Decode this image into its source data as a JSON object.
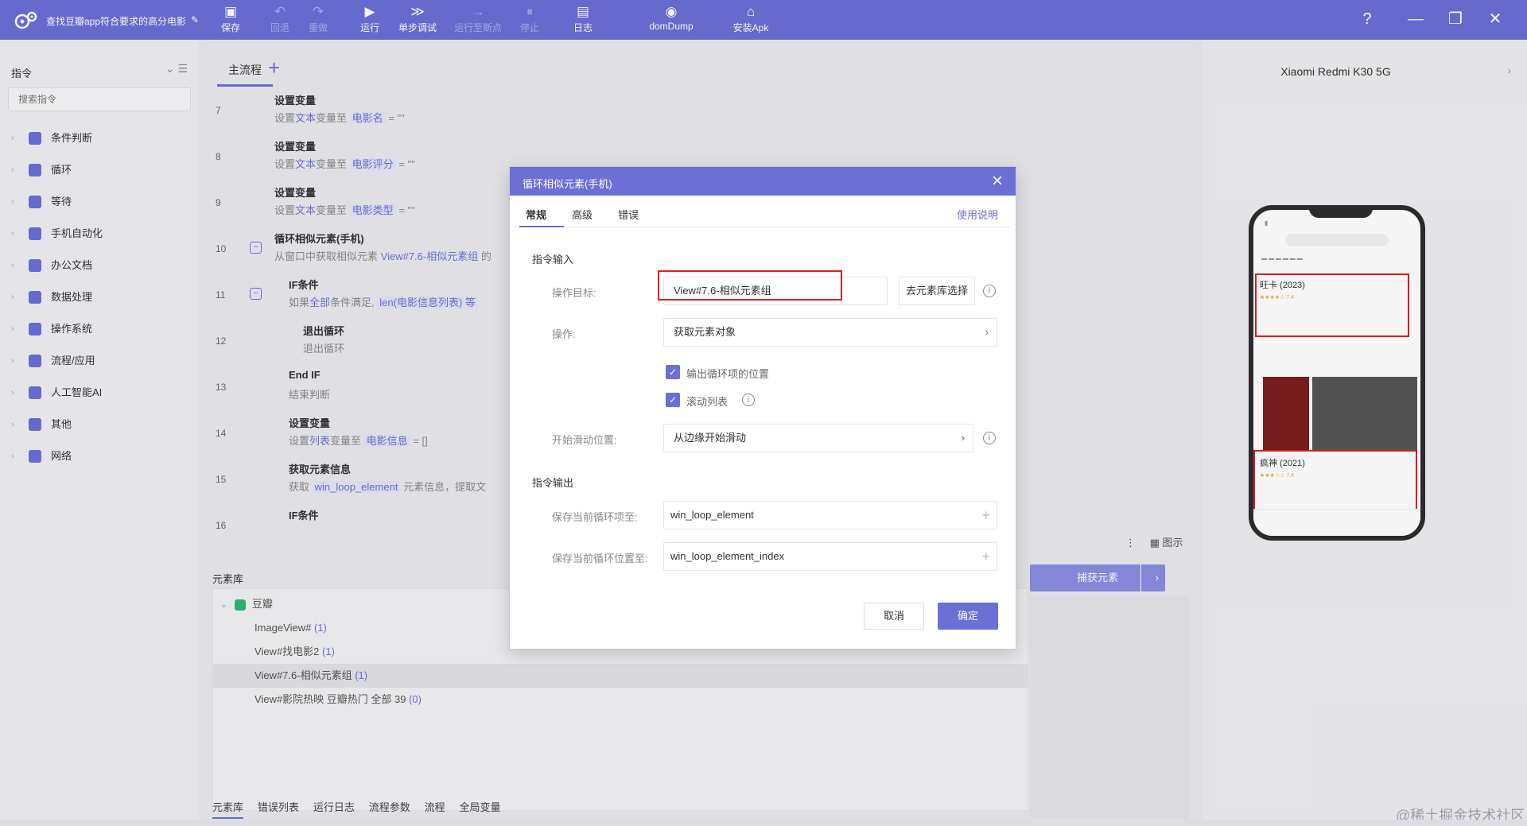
{
  "app": {
    "title": "查找豆瓣app符合要求的高分电影"
  },
  "toolbar": {
    "items": [
      {
        "label": "保存",
        "icon": "save-icon",
        "enabled": true
      },
      {
        "label": "回退",
        "icon": "undo-icon",
        "enabled": false
      },
      {
        "label": "重做",
        "icon": "redo-icon",
        "enabled": false
      },
      {
        "label": "运行",
        "icon": "play-icon",
        "enabled": true
      },
      {
        "label": "单步调试",
        "icon": "step-debug-icon",
        "enabled": true
      },
      {
        "label": "运行至断点",
        "icon": "run-to-breakpoint-icon",
        "enabled": false
      },
      {
        "label": "停止",
        "icon": "stop-icon",
        "enabled": false
      },
      {
        "label": "日志",
        "icon": "log-icon",
        "enabled": true
      },
      {
        "label": "domDump",
        "icon": "dom-dump-icon",
        "enabled": true
      },
      {
        "label": "安装Apk",
        "icon": "install-apk-icon",
        "enabled": true
      }
    ]
  },
  "left_panel": {
    "title": "指令",
    "search_placeholder": "搜索指令",
    "items": [
      {
        "label": "条件判断"
      },
      {
        "label": "循环"
      },
      {
        "label": "等待"
      },
      {
        "label": "手机自动化"
      },
      {
        "label": "办公文档"
      },
      {
        "label": "数据处理"
      },
      {
        "label": "操作系统"
      },
      {
        "label": "流程/应用"
      },
      {
        "label": "人工智能AI"
      },
      {
        "label": "其他"
      },
      {
        "label": "网络"
      }
    ]
  },
  "main": {
    "tab": "主流程",
    "steps": [
      {
        "num": "7",
        "title": "设置变量",
        "desc_prefix": "设置",
        "desc_type": "文本",
        "desc_mid": "变量至",
        "desc_var": "电影名",
        "desc_suffix": "= \"\""
      },
      {
        "num": "8",
        "title": "设置变量",
        "desc_prefix": "设置",
        "desc_type": "文本",
        "desc_mid": "变量至",
        "desc_var": "电影评分",
        "desc_suffix": "= \"\""
      },
      {
        "num": "9",
        "title": "设置变量",
        "desc_prefix": "设置",
        "desc_type": "文本",
        "desc_mid": "变量至",
        "desc_var": "电影类型",
        "desc_suffix": "= \"\""
      },
      {
        "num": "10",
        "title": "循环相似元素(手机)",
        "desc_prefix": "从窗口中获取相似元素",
        "desc_type": "View#7.6-相似元素组",
        "desc_mid": "的",
        "desc_var": "",
        "desc_suffix": ""
      },
      {
        "num": "11",
        "title": "IF条件",
        "desc_prefix": "如果",
        "desc_type": "全部",
        "desc_mid": "条件满足,",
        "desc_var": "len(电影信息列表) 等",
        "desc_suffix": ""
      },
      {
        "num": "12",
        "title": "退出循环",
        "desc_prefix": "退出循环",
        "desc_type": "",
        "desc_mid": "",
        "desc_var": "",
        "desc_suffix": ""
      },
      {
        "num": "13",
        "title": "End IF",
        "desc_prefix": "结束判断",
        "desc_type": "",
        "desc_mid": "",
        "desc_var": "",
        "desc_suffix": ""
      },
      {
        "num": "14",
        "title": "设置变量",
        "desc_prefix": "设置",
        "desc_type": "列表",
        "desc_mid": "变量至",
        "desc_var": "电影信息",
        "desc_suffix": "= []"
      },
      {
        "num": "15",
        "title": "获取元素信息",
        "desc_prefix": "获取",
        "desc_type": "",
        "desc_mid": "",
        "desc_var": "win_loop_element",
        "desc_suffix": "元素信息，提取文"
      },
      {
        "num": "16",
        "title": "IF条件",
        "desc_prefix": "",
        "desc_type": "",
        "desc_mid": "",
        "desc_var": "",
        "desc_suffix": ""
      }
    ]
  },
  "element_library": {
    "title": "元素库",
    "root": "豆瓣",
    "items": [
      {
        "name": "ImageView#",
        "count": "(1)",
        "selected": false
      },
      {
        "name": "View#找电影2",
        "count": "(1)",
        "selected": false
      },
      {
        "name": "View#7.6-相似元素组",
        "count": "(1)",
        "selected": true
      },
      {
        "name": "View#影院热映 豆瓣热门 全部 39",
        "count": "(0)",
        "selected": false
      }
    ],
    "show_image_label": "图示",
    "capture_button": "捕获元素",
    "bottom_tabs": [
      "元素库",
      "错误列表",
      "运行日志",
      "流程参数",
      "流程",
      "全局变量"
    ]
  },
  "device": {
    "name": "Xiaomi Redmi K30 5G",
    "cards": [
      {
        "title": "旺卡 (2023)",
        "rating": "★★★★☆ 7.4"
      },
      {
        "title": "疯神 (2021)",
        "rating": "★★★☆☆ 7.4"
      }
    ]
  },
  "dialog": {
    "title": "循环相似元素(手机)",
    "tabs": [
      "常规",
      "高级",
      "错误"
    ],
    "help_link": "使用说明",
    "input_section": "指令输入",
    "target_label": "操作目标:",
    "target_value": "View#7.6-相似元素组",
    "select_from_lib": "去元素库选择",
    "operation_label": "操作:",
    "operation_value": "获取元素对象",
    "checkbox_output_position": "输出循环项的位置",
    "checkbox_output_position_checked": true,
    "checkbox_scroll_list": "滚动列表",
    "checkbox_scroll_list_checked": true,
    "start_scroll_label": "开始滑动位置:",
    "start_scroll_value": "从边缘开始滑动",
    "output_section": "指令输出",
    "save_item_label": "保存当前循环项至:",
    "save_item_value": "win_loop_element",
    "save_index_label": "保存当前循环位置至:",
    "save_index_value": "win_loop_element_index",
    "cancel_label": "取消",
    "ok_label": "确定"
  },
  "watermark": "@稀土掘金技术社区",
  "colors": {
    "accent": "#6b6fd6",
    "highlight_red": "#e02020",
    "success": "#2bb673"
  }
}
